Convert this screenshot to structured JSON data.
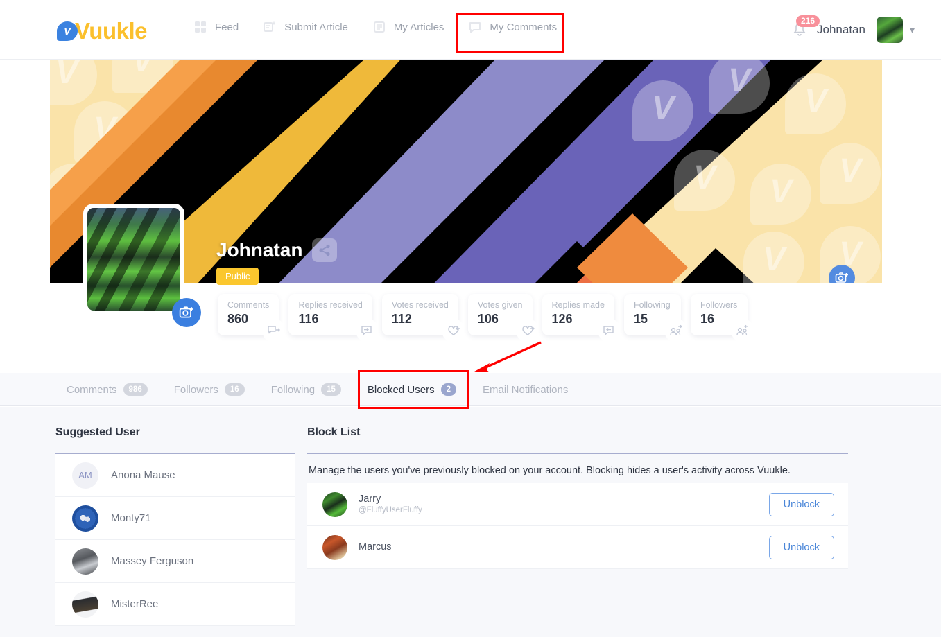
{
  "brand": {
    "name": "Vuukle",
    "logo_letter": "V",
    "accent": "#fbc02d",
    "blue": "#3b82e0"
  },
  "topnav": {
    "items": [
      {
        "label": "Feed",
        "icon": "grid-icon"
      },
      {
        "label": "Submit Article",
        "icon": "submit-article-icon"
      },
      {
        "label": "My Articles",
        "icon": "articles-icon"
      },
      {
        "label": "My Comments",
        "icon": "comment-icon"
      }
    ],
    "notifications_count": "216",
    "username": "Johnatan"
  },
  "profile": {
    "name": "Johnatan",
    "visibility_badge": "Public",
    "stats": [
      {
        "label": "Comments",
        "value": "860",
        "icon": "comment-arrow-icon"
      },
      {
        "label": "Replies received",
        "value": "116",
        "icon": "reply-in-icon"
      },
      {
        "label": "Votes received",
        "value": "112",
        "icon": "heart-in-icon"
      },
      {
        "label": "Votes given",
        "value": "106",
        "icon": "heart-out-icon"
      },
      {
        "label": "Replies made",
        "value": "126",
        "icon": "reply-out-icon"
      },
      {
        "label": "Following",
        "value": "15",
        "icon": "users-out-icon"
      },
      {
        "label": "Followers",
        "value": "16",
        "icon": "users-in-icon"
      }
    ]
  },
  "tabs": [
    {
      "label": "Comments",
      "count": "986",
      "active": false
    },
    {
      "label": "Followers",
      "count": "16",
      "active": false
    },
    {
      "label": "Following",
      "count": "15",
      "active": false
    },
    {
      "label": "Blocked Users",
      "count": "2",
      "active": true
    },
    {
      "label": "Email Notifications",
      "count": "",
      "active": false
    }
  ],
  "suggested": {
    "title": "Suggested User",
    "users": [
      {
        "name": "Anona Mause",
        "initials": "AM",
        "avatar_kind": "initials"
      },
      {
        "name": "Monty71",
        "initials": "",
        "avatar_kind": "monty"
      },
      {
        "name": "Massey Ferguson",
        "initials": "",
        "avatar_kind": "massey"
      },
      {
        "name": "MisterRee",
        "initials": "",
        "avatar_kind": "mister"
      }
    ]
  },
  "block_list": {
    "title": "Block List",
    "description": "Manage the users you've previously blocked on your account. Blocking hides a user's activity across Vuukle.",
    "rows": [
      {
        "name": "Jarry",
        "handle": "@FluffyUserFluffy",
        "action": "Unblock",
        "avatar_kind": "jarry"
      },
      {
        "name": "Marcus",
        "handle": "",
        "action": "Unblock",
        "avatar_kind": "marcus"
      }
    ]
  }
}
